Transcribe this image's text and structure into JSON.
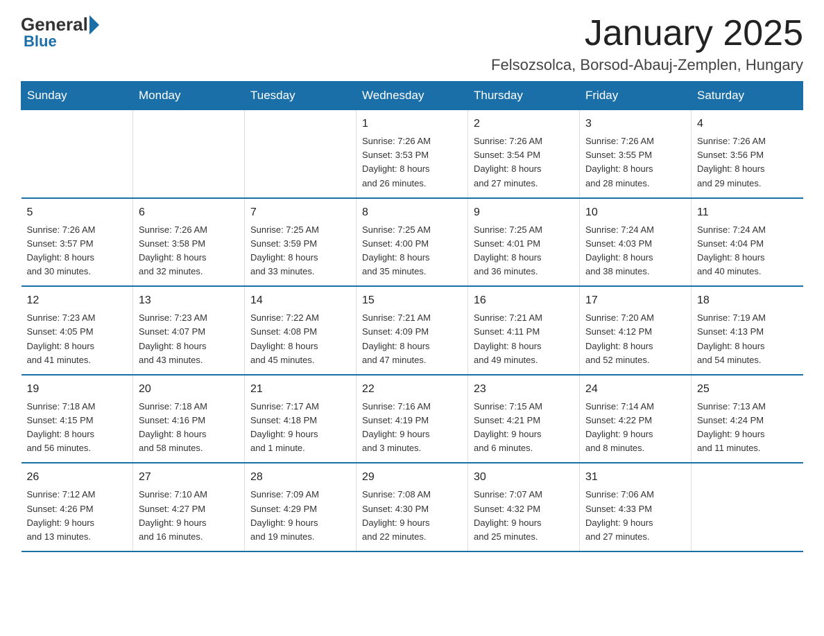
{
  "logo": {
    "text1": "General",
    "text2": "Blue"
  },
  "header": {
    "title": "January 2025",
    "subtitle": "Felsozsolca, Borsod-Abauj-Zemplen, Hungary"
  },
  "weekdays": [
    "Sunday",
    "Monday",
    "Tuesday",
    "Wednesday",
    "Thursday",
    "Friday",
    "Saturday"
  ],
  "weeks": [
    [
      {
        "day": "",
        "info": ""
      },
      {
        "day": "",
        "info": ""
      },
      {
        "day": "",
        "info": ""
      },
      {
        "day": "1",
        "info": "Sunrise: 7:26 AM\nSunset: 3:53 PM\nDaylight: 8 hours\nand 26 minutes."
      },
      {
        "day": "2",
        "info": "Sunrise: 7:26 AM\nSunset: 3:54 PM\nDaylight: 8 hours\nand 27 minutes."
      },
      {
        "day": "3",
        "info": "Sunrise: 7:26 AM\nSunset: 3:55 PM\nDaylight: 8 hours\nand 28 minutes."
      },
      {
        "day": "4",
        "info": "Sunrise: 7:26 AM\nSunset: 3:56 PM\nDaylight: 8 hours\nand 29 minutes."
      }
    ],
    [
      {
        "day": "5",
        "info": "Sunrise: 7:26 AM\nSunset: 3:57 PM\nDaylight: 8 hours\nand 30 minutes."
      },
      {
        "day": "6",
        "info": "Sunrise: 7:26 AM\nSunset: 3:58 PM\nDaylight: 8 hours\nand 32 minutes."
      },
      {
        "day": "7",
        "info": "Sunrise: 7:25 AM\nSunset: 3:59 PM\nDaylight: 8 hours\nand 33 minutes."
      },
      {
        "day": "8",
        "info": "Sunrise: 7:25 AM\nSunset: 4:00 PM\nDaylight: 8 hours\nand 35 minutes."
      },
      {
        "day": "9",
        "info": "Sunrise: 7:25 AM\nSunset: 4:01 PM\nDaylight: 8 hours\nand 36 minutes."
      },
      {
        "day": "10",
        "info": "Sunrise: 7:24 AM\nSunset: 4:03 PM\nDaylight: 8 hours\nand 38 minutes."
      },
      {
        "day": "11",
        "info": "Sunrise: 7:24 AM\nSunset: 4:04 PM\nDaylight: 8 hours\nand 40 minutes."
      }
    ],
    [
      {
        "day": "12",
        "info": "Sunrise: 7:23 AM\nSunset: 4:05 PM\nDaylight: 8 hours\nand 41 minutes."
      },
      {
        "day": "13",
        "info": "Sunrise: 7:23 AM\nSunset: 4:07 PM\nDaylight: 8 hours\nand 43 minutes."
      },
      {
        "day": "14",
        "info": "Sunrise: 7:22 AM\nSunset: 4:08 PM\nDaylight: 8 hours\nand 45 minutes."
      },
      {
        "day": "15",
        "info": "Sunrise: 7:21 AM\nSunset: 4:09 PM\nDaylight: 8 hours\nand 47 minutes."
      },
      {
        "day": "16",
        "info": "Sunrise: 7:21 AM\nSunset: 4:11 PM\nDaylight: 8 hours\nand 49 minutes."
      },
      {
        "day": "17",
        "info": "Sunrise: 7:20 AM\nSunset: 4:12 PM\nDaylight: 8 hours\nand 52 minutes."
      },
      {
        "day": "18",
        "info": "Sunrise: 7:19 AM\nSunset: 4:13 PM\nDaylight: 8 hours\nand 54 minutes."
      }
    ],
    [
      {
        "day": "19",
        "info": "Sunrise: 7:18 AM\nSunset: 4:15 PM\nDaylight: 8 hours\nand 56 minutes."
      },
      {
        "day": "20",
        "info": "Sunrise: 7:18 AM\nSunset: 4:16 PM\nDaylight: 8 hours\nand 58 minutes."
      },
      {
        "day": "21",
        "info": "Sunrise: 7:17 AM\nSunset: 4:18 PM\nDaylight: 9 hours\nand 1 minute."
      },
      {
        "day": "22",
        "info": "Sunrise: 7:16 AM\nSunset: 4:19 PM\nDaylight: 9 hours\nand 3 minutes."
      },
      {
        "day": "23",
        "info": "Sunrise: 7:15 AM\nSunset: 4:21 PM\nDaylight: 9 hours\nand 6 minutes."
      },
      {
        "day": "24",
        "info": "Sunrise: 7:14 AM\nSunset: 4:22 PM\nDaylight: 9 hours\nand 8 minutes."
      },
      {
        "day": "25",
        "info": "Sunrise: 7:13 AM\nSunset: 4:24 PM\nDaylight: 9 hours\nand 11 minutes."
      }
    ],
    [
      {
        "day": "26",
        "info": "Sunrise: 7:12 AM\nSunset: 4:26 PM\nDaylight: 9 hours\nand 13 minutes."
      },
      {
        "day": "27",
        "info": "Sunrise: 7:10 AM\nSunset: 4:27 PM\nDaylight: 9 hours\nand 16 minutes."
      },
      {
        "day": "28",
        "info": "Sunrise: 7:09 AM\nSunset: 4:29 PM\nDaylight: 9 hours\nand 19 minutes."
      },
      {
        "day": "29",
        "info": "Sunrise: 7:08 AM\nSunset: 4:30 PM\nDaylight: 9 hours\nand 22 minutes."
      },
      {
        "day": "30",
        "info": "Sunrise: 7:07 AM\nSunset: 4:32 PM\nDaylight: 9 hours\nand 25 minutes."
      },
      {
        "day": "31",
        "info": "Sunrise: 7:06 AM\nSunset: 4:33 PM\nDaylight: 9 hours\nand 27 minutes."
      },
      {
        "day": "",
        "info": ""
      }
    ]
  ]
}
